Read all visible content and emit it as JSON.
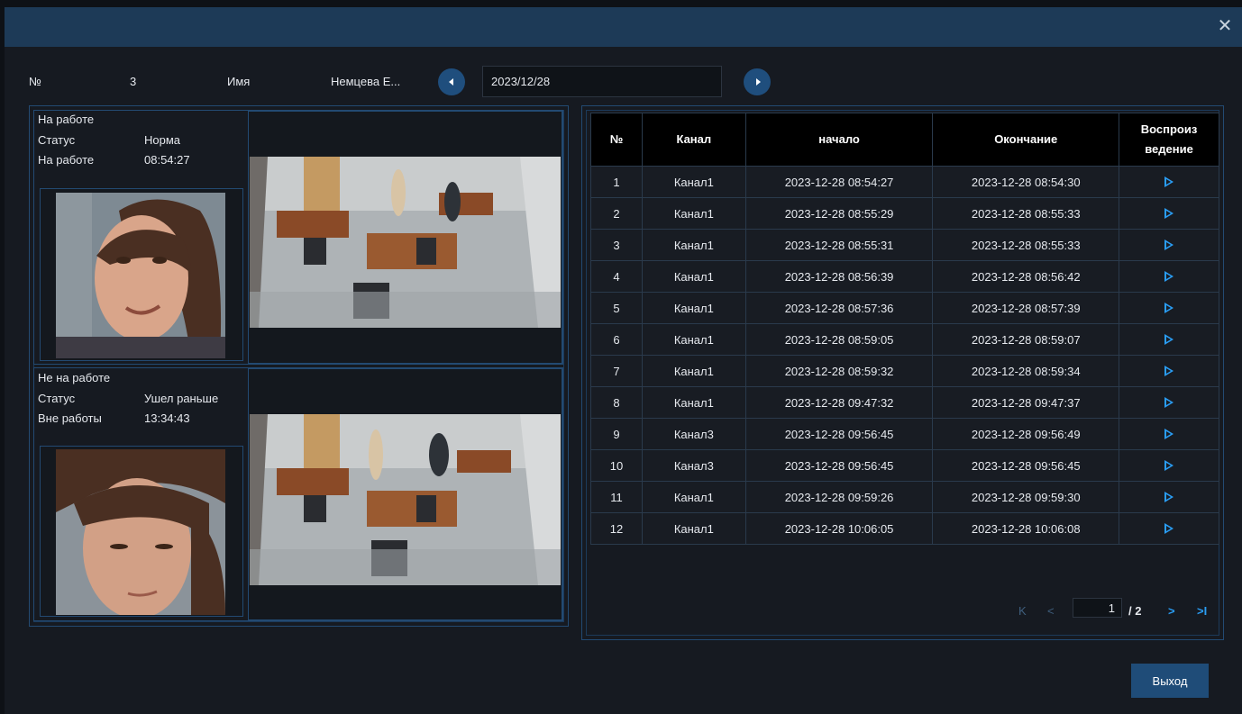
{
  "dialog": {
    "close_glyph": "✕",
    "close_icon": "close-icon"
  },
  "info": {
    "no_label": "№",
    "no_value": "3",
    "name_label": "Имя",
    "name_value": "Немцева Е...",
    "date": "2023/12/28",
    "prev_icon": "chevron-left-icon",
    "next_icon": "chevron-right-icon"
  },
  "records": [
    {
      "heading": "На работе",
      "status_label": "Статус",
      "status_value": "Норма",
      "time_label": "На работе",
      "time_value": "08:54:27"
    },
    {
      "heading": "Не на работе",
      "status_label": "Статус",
      "status_value": "Ушел раньше",
      "time_label": "Вне работы",
      "time_value": "13:34:43"
    }
  ],
  "table": {
    "headers": [
      "№",
      "Канал",
      "начало",
      "Окончание",
      "Воспроиз\nведение"
    ],
    "rows": [
      [
        "1",
        "Канал1",
        "2023-12-28 08:54:27",
        "2023-12-28 08:54:30"
      ],
      [
        "2",
        "Канал1",
        "2023-12-28 08:55:29",
        "2023-12-28 08:55:33"
      ],
      [
        "3",
        "Канал1",
        "2023-12-28 08:55:31",
        "2023-12-28 08:55:33"
      ],
      [
        "4",
        "Канал1",
        "2023-12-28 08:56:39",
        "2023-12-28 08:56:42"
      ],
      [
        "5",
        "Канал1",
        "2023-12-28 08:57:36",
        "2023-12-28 08:57:39"
      ],
      [
        "6",
        "Канал1",
        "2023-12-28 08:59:05",
        "2023-12-28 08:59:07"
      ],
      [
        "7",
        "Канал1",
        "2023-12-28 08:59:32",
        "2023-12-28 08:59:34"
      ],
      [
        "8",
        "Канал1",
        "2023-12-28 09:47:32",
        "2023-12-28 09:47:37"
      ],
      [
        "9",
        "Канал3",
        "2023-12-28 09:56:45",
        "2023-12-28 09:56:49"
      ],
      [
        "10",
        "Канал3",
        "2023-12-28 09:56:45",
        "2023-12-28 09:56:45"
      ],
      [
        "11",
        "Канал1",
        "2023-12-28 09:59:26",
        "2023-12-28 09:59:30"
      ],
      [
        "12",
        "Канал1",
        "2023-12-28 10:06:05",
        "2023-12-28 10:06:08"
      ]
    ],
    "play_icon": "play-icon"
  },
  "pager": {
    "current_page": "1",
    "total": "/ 2",
    "first_glyph": "K",
    "prev_glyph": "<",
    "next_glyph": ">",
    "last_glyph": ">I"
  },
  "footer": {
    "exit_label": "Выход"
  },
  "colors": {
    "titlebar": "#1d3a57",
    "accent": "#1f4e7d",
    "play": "#2a9df4",
    "panel_border": "#234a72"
  }
}
